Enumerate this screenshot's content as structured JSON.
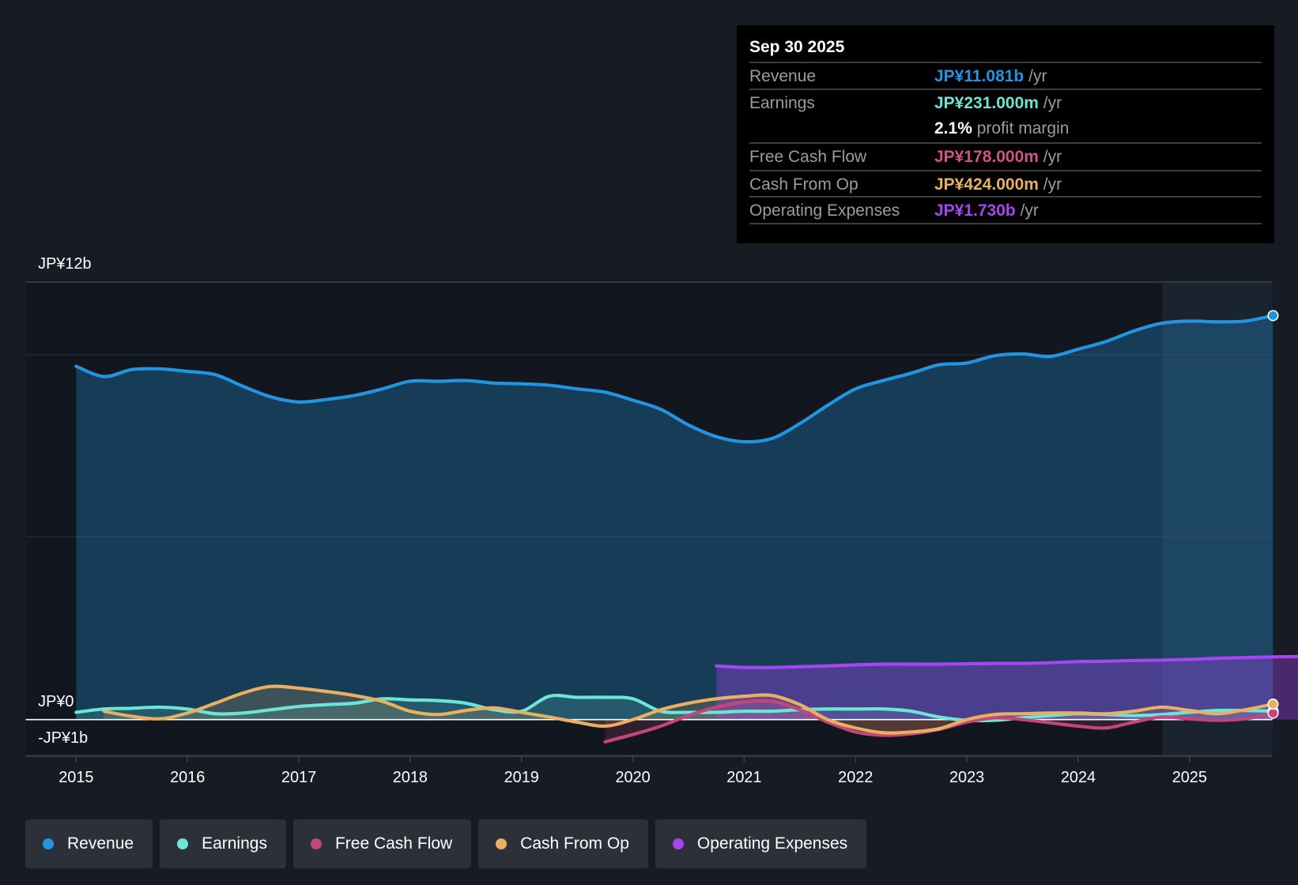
{
  "tooltip": {
    "date": "Sep 30 2025",
    "rows": [
      {
        "label": "Revenue",
        "value": "JP¥11.081b",
        "unit": "/yr",
        "color": "#2394df"
      },
      {
        "label": "Earnings",
        "value": "JP¥231.000m",
        "unit": "/yr",
        "color": "#6ce5d4"
      },
      {
        "label": "",
        "value": "2.1%",
        "unit": "profit margin",
        "color": "#ffffff"
      },
      {
        "label": "Free Cash Flow",
        "value": "JP¥178.000m",
        "unit": "/yr",
        "color": "#d0528a"
      },
      {
        "label": "Cash From Op",
        "value": "JP¥424.000m",
        "unit": "/yr",
        "color": "#e8b060"
      },
      {
        "label": "Operating Expenses",
        "value": "JP¥1.730b",
        "unit": "/yr",
        "color": "#a646f0"
      }
    ]
  },
  "legend": [
    {
      "label": "Revenue",
      "color": "#2394df"
    },
    {
      "label": "Earnings",
      "color": "#6ce5d4"
    },
    {
      "label": "Free Cash Flow",
      "color": "#c2457c"
    },
    {
      "label": "Cash From Op",
      "color": "#e8b060"
    },
    {
      "label": "Operating Expenses",
      "color": "#a646f0"
    }
  ],
  "chart_data": {
    "type": "line",
    "ylabel_top": "JP¥12b",
    "ylabel_zero": "JP¥0",
    "ylabel_bottom": "-JP¥1b",
    "ylim": [
      -1,
      12
    ],
    "unit": "JP¥ billions",
    "xticks": [
      "2015",
      "2016",
      "2017",
      "2018",
      "2019",
      "2020",
      "2021",
      "2022",
      "2023",
      "2024",
      "2025"
    ],
    "past_region_start": 2024.75,
    "series": [
      {
        "name": "Revenue",
        "color": "#2394df",
        "x0": 2015,
        "step": 0.25,
        "values": [
          9.69,
          9.41,
          9.6,
          9.62,
          9.55,
          9.46,
          9.14,
          8.85,
          8.71,
          8.78,
          8.89,
          9.07,
          9.28,
          9.28,
          9.3,
          9.23,
          9.21,
          9.17,
          9.07,
          8.98,
          8.76,
          8.51,
          8.08,
          7.76,
          7.62,
          7.71,
          8.12,
          8.62,
          9.07,
          9.3,
          9.5,
          9.73,
          9.78,
          9.98,
          10.03,
          9.96,
          10.16,
          10.37,
          10.66,
          10.87,
          10.93,
          10.91,
          10.93,
          11.081
        ]
      },
      {
        "name": "Earnings",
        "color": "#6ce5d4",
        "x0": 2015,
        "step": 0.25,
        "values": [
          0.2,
          0.29,
          0.31,
          0.34,
          0.29,
          0.16,
          0.18,
          0.27,
          0.36,
          0.41,
          0.45,
          0.57,
          0.54,
          0.52,
          0.45,
          0.27,
          0.23,
          0.64,
          0.61,
          0.61,
          0.57,
          0.23,
          0.2,
          0.2,
          0.23,
          0.23,
          0.27,
          0.29,
          0.29,
          0.29,
          0.23,
          0.07,
          -0.02,
          -0.02,
          0.05,
          0.11,
          0.16,
          0.14,
          0.11,
          0.14,
          0.2,
          0.25,
          0.25,
          0.231
        ]
      },
      {
        "name": "Free Cash Flow",
        "color": "#c2457c",
        "x0": 2019.75,
        "step": 0.25,
        "values": [
          -0.61,
          -0.41,
          -0.18,
          0.11,
          0.34,
          0.48,
          0.5,
          0.27,
          -0.07,
          -0.34,
          -0.43,
          -0.39,
          -0.27,
          -0.07,
          0.05,
          0,
          -0.09,
          -0.18,
          -0.23,
          -0.07,
          0.07,
          0.02,
          -0.02,
          0.02,
          0.178
        ]
      },
      {
        "name": "Cash From Op",
        "color": "#e8b060",
        "x0": 2015.25,
        "step": 0.25,
        "values": [
          0.23,
          0.09,
          0.02,
          0.18,
          0.45,
          0.73,
          0.91,
          0.86,
          0.77,
          0.66,
          0.5,
          0.23,
          0.14,
          0.25,
          0.32,
          0.2,
          0.07,
          -0.07,
          -0.18,
          0,
          0.27,
          0.45,
          0.57,
          0.64,
          0.66,
          0.41,
          0,
          -0.23,
          -0.36,
          -0.34,
          -0.25,
          0,
          0.14,
          0.16,
          0.18,
          0.18,
          0.16,
          0.23,
          0.34,
          0.25,
          0.16,
          0.27,
          0.424
        ]
      },
      {
        "name": "Operating Expenses",
        "color": "#a646f0",
        "x0": 2020.75,
        "step": 0.25,
        "values": [
          1.47,
          1.43,
          1.43,
          1.45,
          1.47,
          1.5,
          1.52,
          1.52,
          1.52,
          1.53,
          1.54,
          1.54,
          1.56,
          1.59,
          1.6,
          1.62,
          1.63,
          1.65,
          1.68,
          1.7,
          1.72,
          1.73,
          1.75,
          1.73,
          1.73
        ]
      }
    ]
  }
}
